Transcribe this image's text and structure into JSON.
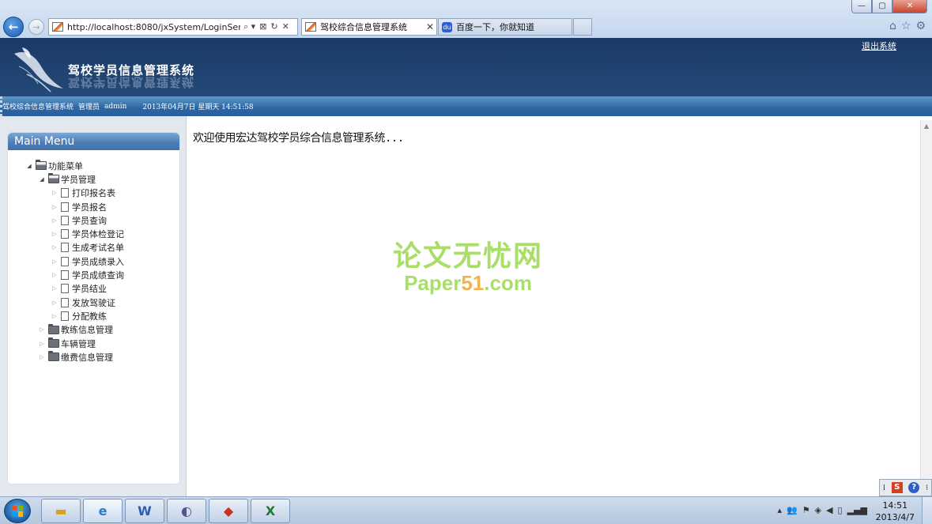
{
  "browser": {
    "url": "http://localhost:8080/jxSystem/LoginServlet",
    "addr_tools": [
      "⌕ ▾",
      "⊠",
      "↻",
      "✕"
    ],
    "tabs": [
      {
        "title": "驾校综合信息管理系统",
        "close": "✕"
      },
      {
        "title": "百度一下，你就知道"
      }
    ],
    "window_controls": [
      "—",
      "▢",
      "✕"
    ],
    "right_tools": [
      "⌂",
      "☆",
      "⚙"
    ],
    "baidu_glyph": "du"
  },
  "header": {
    "title": "驾校学员信息管理系统",
    "logout": "退出系统"
  },
  "status_bar": {
    "system_name": "驾校综合信息管理系统",
    "role": "管理员",
    "user": "admin",
    "datetime": "2013年04月7日 星期天 14:51:58"
  },
  "sidebar": {
    "menu_title": "Main Menu",
    "tree": {
      "root": "功能菜单",
      "group1": {
        "label": "学员管理",
        "items": [
          "打印报名表",
          "学员报名",
          "学员查询",
          "学员体检登记",
          "生成考试名单",
          "学员成绩录入",
          "学员成绩查询",
          "学员结业",
          "发放驾驶证",
          "分配教练"
        ]
      },
      "group2": "教练信息管理",
      "group3": "车辆管理",
      "group4": "缴费信息管理"
    }
  },
  "main": {
    "welcome": "欢迎使用宏达驾校学员综合信息管理系统...",
    "watermark_line1": "论文无忧网",
    "watermark_pre": "Paper",
    "watermark_num": "51",
    "watermark_post": ".com"
  },
  "ime": {
    "mode": "S",
    "help": "?"
  },
  "taskbar": {
    "clock_time": "14:51",
    "clock_date": "2013/4/7"
  },
  "colors": {
    "header_bg": "#1b3a66",
    "status_bar": "#2c65a2",
    "menu_header": "#4d7fb9",
    "watermark_green": "#9bd94e",
    "watermark_orange": "#f2a62d"
  }
}
